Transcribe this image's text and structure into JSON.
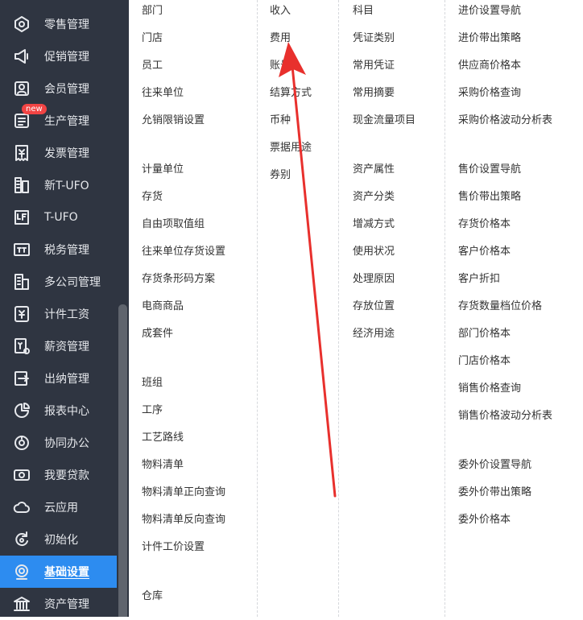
{
  "sidebar": {
    "items": [
      {
        "label": "零售管理",
        "icon": "retail-icon"
      },
      {
        "label": "促销管理",
        "icon": "promotion-icon"
      },
      {
        "label": "会员管理",
        "icon": "member-icon"
      },
      {
        "label": "生产管理",
        "icon": "production-icon",
        "badge": "new"
      },
      {
        "label": "发票管理",
        "icon": "invoice-icon"
      },
      {
        "label": "新T-UFO",
        "icon": "new-tufo-icon"
      },
      {
        "label": "T-UFO",
        "icon": "tufo-icon"
      },
      {
        "label": "税务管理",
        "icon": "tax-icon"
      },
      {
        "label": "多公司管理",
        "icon": "multi-company-icon"
      },
      {
        "label": "计件工资",
        "icon": "piecework-wage-icon"
      },
      {
        "label": "薪资管理",
        "icon": "salary-icon"
      },
      {
        "label": "出纳管理",
        "icon": "cashier-icon"
      },
      {
        "label": "报表中心",
        "icon": "report-icon"
      },
      {
        "label": "协同办公",
        "icon": "collaboration-icon"
      },
      {
        "label": "我要贷款",
        "icon": "loan-icon"
      },
      {
        "label": "云应用",
        "icon": "cloud-icon"
      },
      {
        "label": "初始化",
        "icon": "init-icon"
      },
      {
        "label": "基础设置",
        "icon": "basic-settings-icon",
        "active": true
      },
      {
        "label": "资产管理",
        "icon": "asset-icon"
      }
    ]
  },
  "menu": {
    "col1": {
      "g1": [
        "部门",
        "门店",
        "员工",
        "往来单位",
        "允销限销设置"
      ],
      "g2": [
        "计量单位",
        "存货",
        "自由项取值组",
        "往来单位存货设置",
        "存货条形码方案",
        "电商商品",
        "成套件"
      ],
      "g3": [
        "班组",
        "工序",
        "工艺路线",
        "物料清单",
        "物料清单正向查询",
        "物料清单反向查询",
        "计件工价设置"
      ],
      "g4": [
        "仓库"
      ]
    },
    "col2": {
      "g1": [
        "收入",
        "费用",
        "账号",
        "结算方式",
        "币种",
        "票据用途",
        "券别"
      ]
    },
    "col3": {
      "g1": [
        "科目",
        "凭证类别",
        "常用凭证",
        "常用摘要",
        "现金流量项目"
      ],
      "g2": [
        "资产属性",
        "资产分类",
        "增减方式",
        "使用状况",
        "处理原因",
        "存放位置",
        "经济用途"
      ]
    },
    "col4": {
      "g1": [
        "进价设置导航",
        "进价带出策略",
        "供应商价格本",
        "采购价格查询",
        "采购价格波动分析表"
      ],
      "g2": [
        "售价设置导航",
        "售价带出策略",
        "存货价格本",
        "客户价格本",
        "客户折扣",
        "存货数量档位价格",
        "部门价格本",
        "门店价格本",
        "销售价格查询",
        "销售价格波动分析表"
      ],
      "g3": [
        "委外价设置导航",
        "委外价带出策略",
        "委外价格本"
      ]
    }
  },
  "colors": {
    "sidebar_bg": "#2f3541",
    "active_bg": "#2d8cf0",
    "arrow": "#e8302d",
    "badge": "#f24444"
  }
}
